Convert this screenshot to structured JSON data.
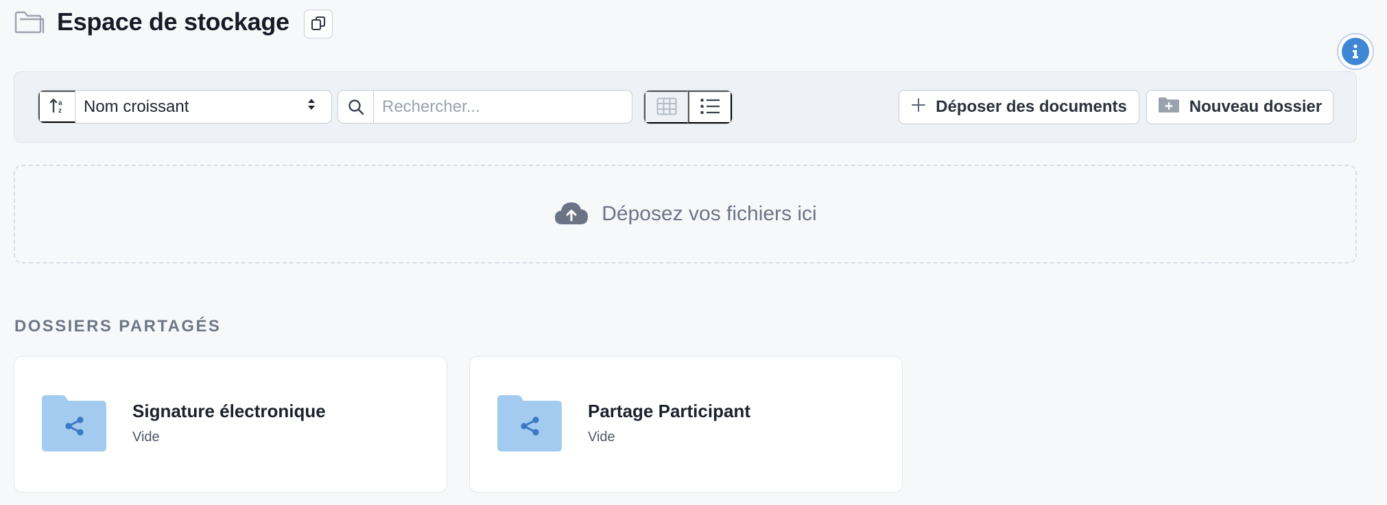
{
  "header": {
    "title": "Espace de stockage"
  },
  "toolbar": {
    "sort_value": "Nom croissant",
    "search_placeholder": "Rechercher...",
    "upload_label": "Déposer des documents",
    "new_folder_label": "Nouveau dossier"
  },
  "dropzone": {
    "text": "Déposez vos fichiers ici"
  },
  "shared": {
    "title": "DOSSIERS PARTAGÉS",
    "folders": [
      {
        "name": "Signature électronique",
        "status": "Vide"
      },
      {
        "name": "Partage Participant",
        "status": "Vide"
      }
    ]
  },
  "colors": {
    "accent": "#3f86d6",
    "folder": "#a3cbf0",
    "folder_icon": "#3d78c4"
  },
  "icons": {
    "header": "folder-outline-icon",
    "copy": "copy-icon",
    "info": "info-icon",
    "sort": "sort-icon",
    "search": "search-icon",
    "grid": "grid-icon",
    "list": "list-icon",
    "plus": "plus-icon",
    "new_folder": "folder-plus-icon",
    "upload": "cloud-upload-icon",
    "share": "share-icon"
  }
}
